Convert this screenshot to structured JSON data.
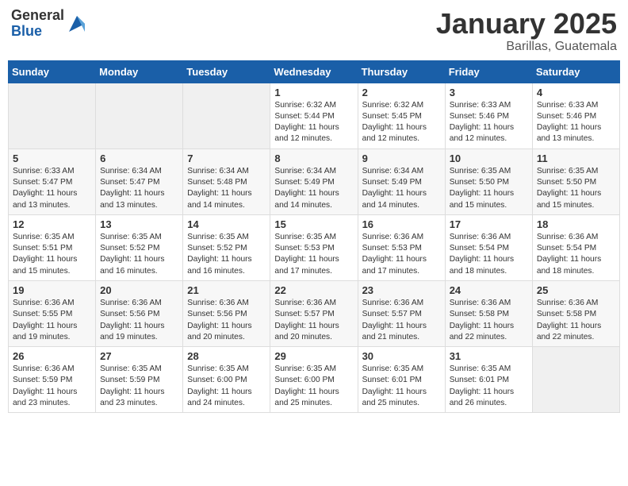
{
  "logo": {
    "general": "General",
    "blue": "Blue"
  },
  "title": "January 2025",
  "location": "Barillas, Guatemala",
  "days_header": [
    "Sunday",
    "Monday",
    "Tuesday",
    "Wednesday",
    "Thursday",
    "Friday",
    "Saturday"
  ],
  "weeks": [
    [
      {
        "day": "",
        "content": ""
      },
      {
        "day": "",
        "content": ""
      },
      {
        "day": "",
        "content": ""
      },
      {
        "day": "1",
        "content": "Sunrise: 6:32 AM\nSunset: 5:44 PM\nDaylight: 11 hours\nand 12 minutes."
      },
      {
        "day": "2",
        "content": "Sunrise: 6:32 AM\nSunset: 5:45 PM\nDaylight: 11 hours\nand 12 minutes."
      },
      {
        "day": "3",
        "content": "Sunrise: 6:33 AM\nSunset: 5:46 PM\nDaylight: 11 hours\nand 12 minutes."
      },
      {
        "day": "4",
        "content": "Sunrise: 6:33 AM\nSunset: 5:46 PM\nDaylight: 11 hours\nand 13 minutes."
      }
    ],
    [
      {
        "day": "5",
        "content": "Sunrise: 6:33 AM\nSunset: 5:47 PM\nDaylight: 11 hours\nand 13 minutes."
      },
      {
        "day": "6",
        "content": "Sunrise: 6:34 AM\nSunset: 5:47 PM\nDaylight: 11 hours\nand 13 minutes."
      },
      {
        "day": "7",
        "content": "Sunrise: 6:34 AM\nSunset: 5:48 PM\nDaylight: 11 hours\nand 14 minutes."
      },
      {
        "day": "8",
        "content": "Sunrise: 6:34 AM\nSunset: 5:49 PM\nDaylight: 11 hours\nand 14 minutes."
      },
      {
        "day": "9",
        "content": "Sunrise: 6:34 AM\nSunset: 5:49 PM\nDaylight: 11 hours\nand 14 minutes."
      },
      {
        "day": "10",
        "content": "Sunrise: 6:35 AM\nSunset: 5:50 PM\nDaylight: 11 hours\nand 15 minutes."
      },
      {
        "day": "11",
        "content": "Sunrise: 6:35 AM\nSunset: 5:50 PM\nDaylight: 11 hours\nand 15 minutes."
      }
    ],
    [
      {
        "day": "12",
        "content": "Sunrise: 6:35 AM\nSunset: 5:51 PM\nDaylight: 11 hours\nand 15 minutes."
      },
      {
        "day": "13",
        "content": "Sunrise: 6:35 AM\nSunset: 5:52 PM\nDaylight: 11 hours\nand 16 minutes."
      },
      {
        "day": "14",
        "content": "Sunrise: 6:35 AM\nSunset: 5:52 PM\nDaylight: 11 hours\nand 16 minutes."
      },
      {
        "day": "15",
        "content": "Sunrise: 6:35 AM\nSunset: 5:53 PM\nDaylight: 11 hours\nand 17 minutes."
      },
      {
        "day": "16",
        "content": "Sunrise: 6:36 AM\nSunset: 5:53 PM\nDaylight: 11 hours\nand 17 minutes."
      },
      {
        "day": "17",
        "content": "Sunrise: 6:36 AM\nSunset: 5:54 PM\nDaylight: 11 hours\nand 18 minutes."
      },
      {
        "day": "18",
        "content": "Sunrise: 6:36 AM\nSunset: 5:54 PM\nDaylight: 11 hours\nand 18 minutes."
      }
    ],
    [
      {
        "day": "19",
        "content": "Sunrise: 6:36 AM\nSunset: 5:55 PM\nDaylight: 11 hours\nand 19 minutes."
      },
      {
        "day": "20",
        "content": "Sunrise: 6:36 AM\nSunset: 5:56 PM\nDaylight: 11 hours\nand 19 minutes."
      },
      {
        "day": "21",
        "content": "Sunrise: 6:36 AM\nSunset: 5:56 PM\nDaylight: 11 hours\nand 20 minutes."
      },
      {
        "day": "22",
        "content": "Sunrise: 6:36 AM\nSunset: 5:57 PM\nDaylight: 11 hours\nand 20 minutes."
      },
      {
        "day": "23",
        "content": "Sunrise: 6:36 AM\nSunset: 5:57 PM\nDaylight: 11 hours\nand 21 minutes."
      },
      {
        "day": "24",
        "content": "Sunrise: 6:36 AM\nSunset: 5:58 PM\nDaylight: 11 hours\nand 22 minutes."
      },
      {
        "day": "25",
        "content": "Sunrise: 6:36 AM\nSunset: 5:58 PM\nDaylight: 11 hours\nand 22 minutes."
      }
    ],
    [
      {
        "day": "26",
        "content": "Sunrise: 6:36 AM\nSunset: 5:59 PM\nDaylight: 11 hours\nand 23 minutes."
      },
      {
        "day": "27",
        "content": "Sunrise: 6:35 AM\nSunset: 5:59 PM\nDaylight: 11 hours\nand 23 minutes."
      },
      {
        "day": "28",
        "content": "Sunrise: 6:35 AM\nSunset: 6:00 PM\nDaylight: 11 hours\nand 24 minutes."
      },
      {
        "day": "29",
        "content": "Sunrise: 6:35 AM\nSunset: 6:00 PM\nDaylight: 11 hours\nand 25 minutes."
      },
      {
        "day": "30",
        "content": "Sunrise: 6:35 AM\nSunset: 6:01 PM\nDaylight: 11 hours\nand 25 minutes."
      },
      {
        "day": "31",
        "content": "Sunrise: 6:35 AM\nSunset: 6:01 PM\nDaylight: 11 hours\nand 26 minutes."
      },
      {
        "day": "",
        "content": ""
      }
    ]
  ]
}
